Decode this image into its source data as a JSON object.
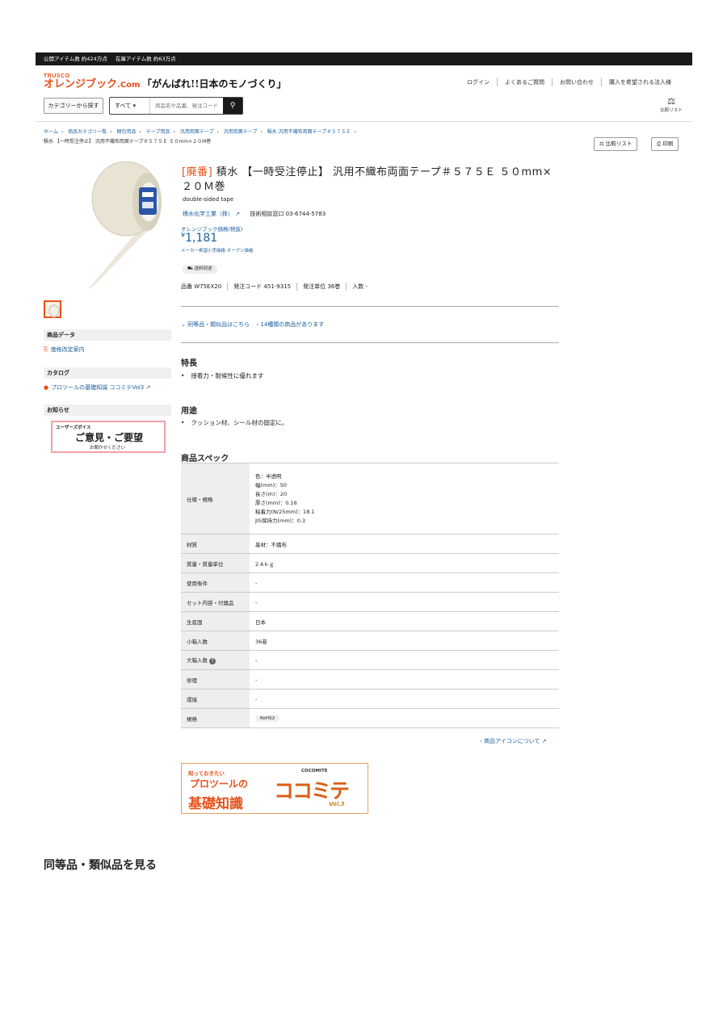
{
  "topbar": {
    "public_items": "公開アイテム数 約424万点",
    "stock_items": "在庫アイテム数 約63万点"
  },
  "header": {
    "logo_top": "TRUSCO",
    "logo_brand": "オレンジブック",
    "logo_suffix": ".Com",
    "slogan": "「がんばれ!!日本のモノづくり」",
    "nav": [
      "ログイン",
      "よくあるご質問",
      "お問い合わせ",
      "購入を希望される法人様"
    ],
    "category_button": "カテゴリーから探す",
    "search_scope": "すべて",
    "search_placeholder": "商品名や品番、発注コード",
    "compare_label": "比較リスト"
  },
  "breadcrumb": {
    "items": [
      "ホーム",
      "商品カテゴリ一覧",
      "梱包用品",
      "テープ用品",
      "汎用両面テープ",
      "汎用両面テープ",
      "積水 汎用不織布両面テープ＃５７５Ｅ"
    ],
    "current": "積水 【一時受注停止】 汎用不織布両面テープ＃５７５Ｅ ５０mm×２０M巻"
  },
  "actions": {
    "compare": "比較リスト",
    "print": "印刷"
  },
  "sidebar": {
    "data_heading": "商品データ",
    "price_link": "価格改定案内",
    "catalog_heading": "カタログ",
    "catalog_link": "プロツールの基礎知識 ココミテVol3",
    "news_heading": "お知らせ",
    "voice_l1": "ユーザーズボイス",
    "voice_l2": "ご意見・ご要望",
    "voice_l3": "お聞かせください"
  },
  "product": {
    "discontinued": "[廃番]",
    "title": "積水 【一時受注停止】 汎用不織布両面テープ＃５７５Ｅ ５０mm×２０Ｍ巻",
    "subtitle": "double-sided tape",
    "maker": "積水化学工業（株）",
    "support": "技術相談窓口 03-6744-5783",
    "price_label": "オレンジブック価格(税抜)",
    "currency": "¥",
    "price": "1,181",
    "price_note": "メーカー希望小売価格 オープン価格",
    "shipping": "送料別途",
    "part_no": "品番 W75EX20",
    "order_code": "発注コード 451-9315",
    "order_unit": "発注単位 36巻",
    "quantity": "入数 -",
    "similar_link": "同等品・類似品はこちら",
    "similar_count": "14種類の商品があります"
  },
  "features": {
    "heading": "特長",
    "item": "接着力・耐候性に優れます"
  },
  "usage": {
    "heading": "用途",
    "item": "クッション材、シール材の固定に。"
  },
  "spec": {
    "heading": "商品スペック",
    "size_label": "仕様・規格",
    "size_lines": [
      "色：半透明",
      "幅(mm)：50",
      "長さ(m)：20",
      "厚さ(mm)：0.16",
      "粘着力(N/25mm)：18.1",
      "JIS保持力(mm)：0.3"
    ],
    "rows": [
      {
        "k": "材質",
        "v": "基材：不織布"
      },
      {
        "k": "質量・質量単位",
        "v": "2.6ｋｇ"
      },
      {
        "k": "使用条件",
        "v": "-"
      },
      {
        "k": "セット内容・付属品",
        "v": "-"
      },
      {
        "k": "生産国",
        "v": "日本"
      },
      {
        "k": "小箱入数",
        "v": "36巻"
      },
      {
        "k": "大箱入数",
        "v": "-"
      },
      {
        "k": "修理",
        "v": "-"
      },
      {
        "k": "環境",
        "v": "-"
      }
    ],
    "standard_label": "規格",
    "standard_value": "RoHS2",
    "icon_link": "商品アイコンについて"
  },
  "banner": {
    "l1": "知っておきたい",
    "l2": "プロツールの",
    "l3": "基礎知識",
    "l4": "ココミテ",
    "l5": "COCOMITE",
    "l6": "Vol.3"
  },
  "bottom_heading": "同等品・類似品を見る"
}
